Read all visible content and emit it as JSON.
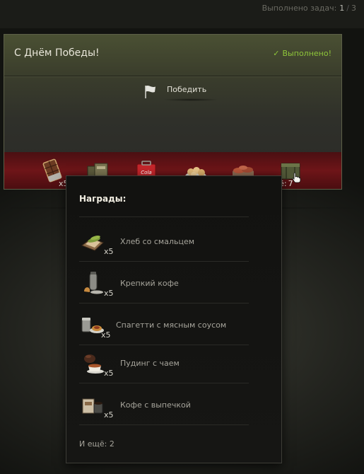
{
  "header": {
    "tasks_label": "Выполнено задач:",
    "tasks_done": "1",
    "tasks_sep": "/",
    "tasks_total": "3"
  },
  "quest": {
    "title": "С Днём Победы!",
    "status_check": "✓",
    "status": "Выполнено!",
    "condition": "Победить",
    "accent_color": "#8fc63a",
    "strip_color": "#6e1518"
  },
  "strip": {
    "icons": [
      "chocolate-bar-icon",
      "ration-crate-icon",
      "cola-box-icon",
      "pastry-plate-icon",
      "meat-tray-icon",
      "ammo-crate-icon"
    ],
    "first_qty": "x5",
    "more_label": "ещё:",
    "more_count": "7"
  },
  "tooltip": {
    "title": "Награды:",
    "items": [
      {
        "name": "Хлеб со смальцем",
        "qty": "x5",
        "icon": "bread-lard-icon"
      },
      {
        "name": "Крепкий кофе",
        "qty": "x5",
        "icon": "strong-coffee-icon"
      },
      {
        "name": "Спагетти с мясным соусом",
        "qty": "x5",
        "icon": "spaghetti-icon"
      },
      {
        "name": "Пудинг с чаем",
        "qty": "x5",
        "icon": "pudding-tea-icon"
      },
      {
        "name": "Кофе с выпечкой",
        "qty": "x5",
        "icon": "coffee-pastry-icon"
      }
    ],
    "footer": "И ещё: 2"
  }
}
